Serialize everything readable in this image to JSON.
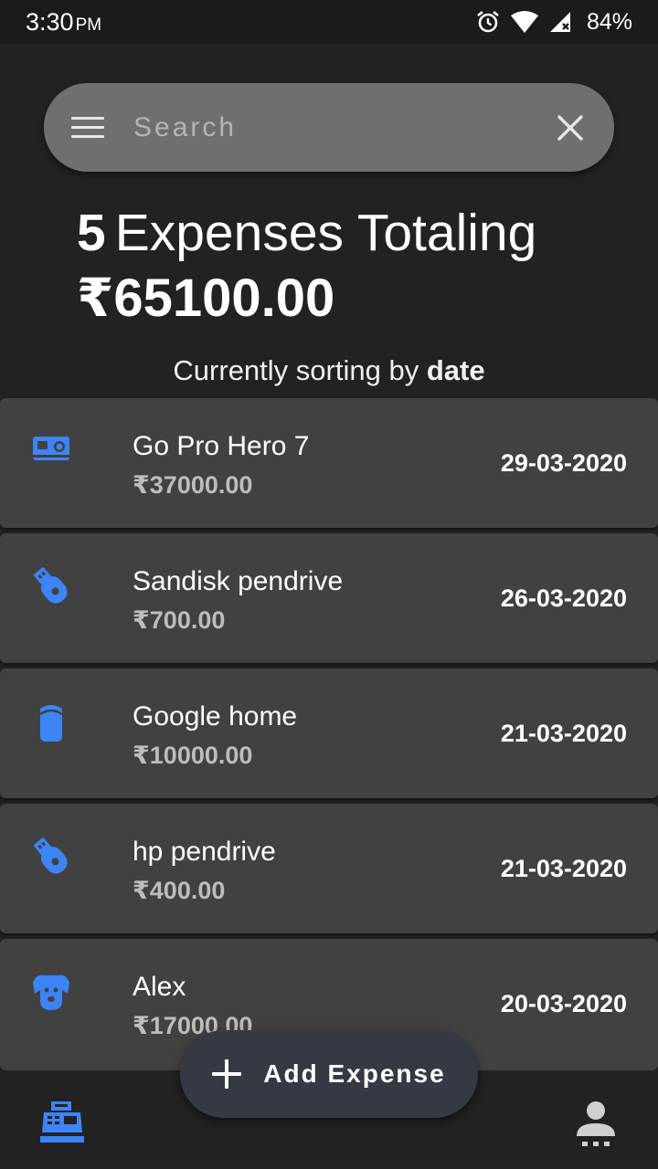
{
  "status_bar": {
    "time": "3:30",
    "ampm": "PM",
    "battery": "84%",
    "icons": [
      "alarm-icon",
      "wifi-icon",
      "signal-icon",
      "battery-icon"
    ]
  },
  "search": {
    "placeholder": "Search",
    "value": "",
    "menu_icon": "menu-icon",
    "clear_icon": "close-icon"
  },
  "summary": {
    "count": "5",
    "label": "Expenses Totaling",
    "total": "₹65100.00"
  },
  "sorting": {
    "prefix": "Currently sorting by",
    "key": "date"
  },
  "expenses": [
    {
      "name": "Go Pro Hero 7",
      "amount": "₹37000.00",
      "date": "29-03-2020",
      "icon": "camera-icon"
    },
    {
      "name": "Sandisk pendrive",
      "amount": "₹700.00",
      "date": "26-03-2020",
      "icon": "usb-drive-icon"
    },
    {
      "name": "Google home",
      "amount": "₹10000.00",
      "date": "21-03-2020",
      "icon": "smart-speaker-icon"
    },
    {
      "name": "hp pendrive",
      "amount": "₹400.00",
      "date": "21-03-2020",
      "icon": "usb-drive-icon"
    },
    {
      "name": "Alex",
      "amount": "₹17000.00",
      "date": "20-03-2020",
      "icon": "dog-icon"
    }
  ],
  "fab": {
    "label": "Add Expense",
    "icon": "plus-icon"
  },
  "bottom_nav": {
    "left_icon": "cash-register-icon",
    "right_icon": "profile-icon"
  },
  "colors": {
    "accent": "#3d84f5",
    "background": "#222222",
    "card": "#414141",
    "fab": "#353941"
  }
}
